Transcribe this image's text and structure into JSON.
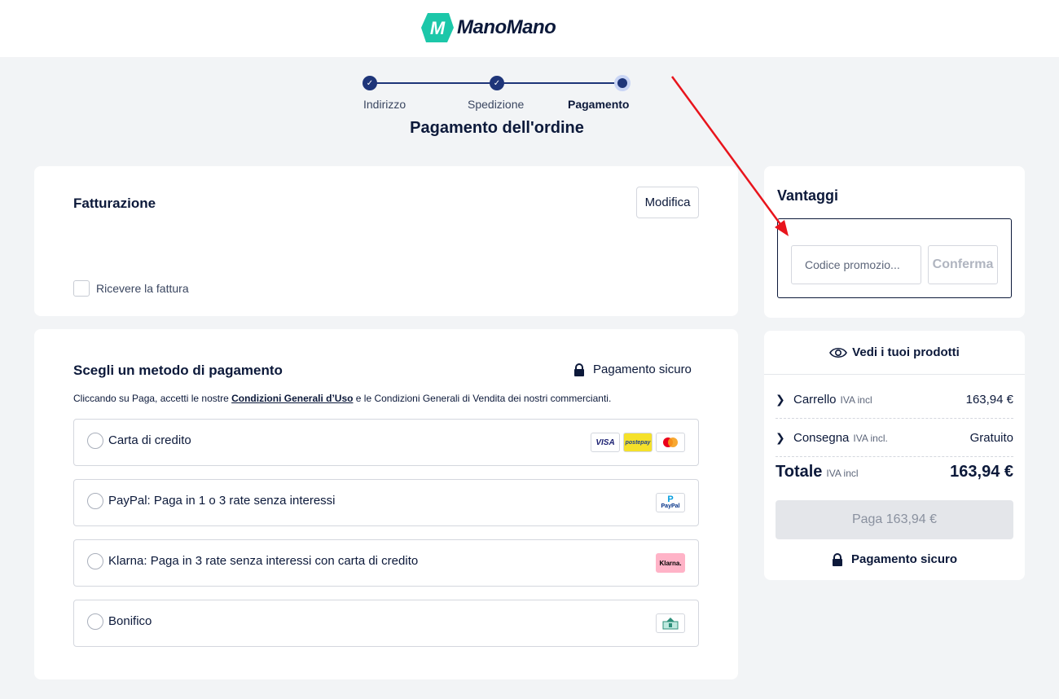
{
  "brand": {
    "name": "ManoMano",
    "color": "#0c193a",
    "accent": "#1cc7a9"
  },
  "stepper": {
    "steps": [
      {
        "label": "Indirizzo",
        "state": "done"
      },
      {
        "label": "Spedizione",
        "state": "done"
      },
      {
        "label": "Pagamento",
        "state": "current"
      }
    ]
  },
  "page_title": "Pagamento dell'ordine",
  "billing": {
    "title": "Fatturazione",
    "modify_label": "Modifica",
    "invoice_checkbox_label": "Ricevere la fattura"
  },
  "payment": {
    "title": "Scegli un metodo di pagamento",
    "secure_label": "Pagamento sicuro",
    "terms_prefix": "Cliccando su Paga, accetti le nostre ",
    "terms_link": "Condizioni Generali d’Uso",
    "terms_suffix": " e le Condizioni Generali di Vendita dei nostri commercianti.",
    "methods": [
      {
        "label": "Carta di credito",
        "icons": [
          "visa-icon",
          "postepay-icon",
          "mastercard-icon"
        ]
      },
      {
        "label": "PayPal: Paga in 1 o 3 rate senza interessi",
        "icons": [
          "paypal-icon"
        ]
      },
      {
        "label": "Klarna: Paga in 3 rate senza interessi con carta di credito",
        "icons": [
          "klarna-icon"
        ]
      },
      {
        "label": "Bonifico",
        "icons": [
          "bank-transfer-icon"
        ]
      }
    ],
    "icon_text": {
      "visa": "VISA",
      "postepay": "postepay",
      "paypal": "PayPal",
      "klarna": "Klarna."
    }
  },
  "advantages": {
    "title": "Vantaggi",
    "promo_placeholder": "Codice promozio...",
    "confirm_label": "Conferma"
  },
  "summary": {
    "view_products_label": "Vedi i tuoi prodotti",
    "cart_label": "Carrello",
    "cart_sub": "IVA incl",
    "cart_value": "163,94 €",
    "delivery_label": "Consegna",
    "delivery_sub": "IVA incl.",
    "delivery_value": "Gratuito",
    "total_label": "Totale",
    "total_sub": "IVA incl",
    "total_value": "163,94 €",
    "pay_button_label": "Paga 163,94 €",
    "secure_label": "Pagamento sicuro"
  },
  "annotation_color": "#e8141c"
}
